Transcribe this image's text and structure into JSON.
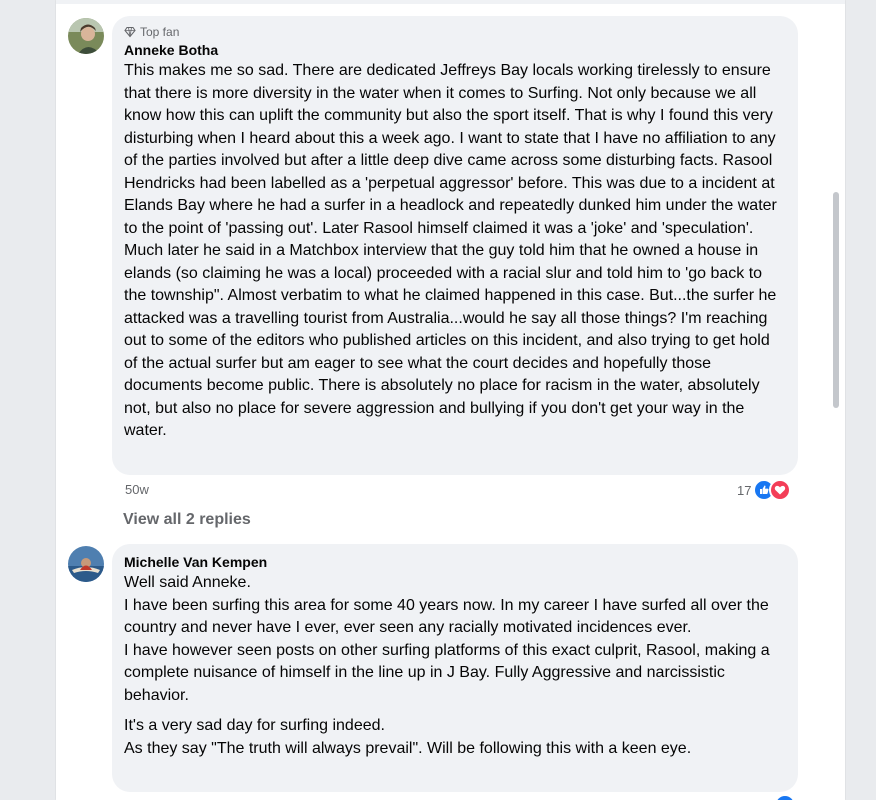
{
  "comments": [
    {
      "badge": "Top fan",
      "author": "Anneke Botha",
      "text": "This makes me so sad. There are dedicated Jeffreys Bay locals working tirelessly to ensure that there is more diversity in the water when it comes to Surfing. Not only because we all know how this can uplift the community but also the sport itself. That is why I found this very disturbing when I heard about this a week ago. I want to state that I have no affiliation to any of the parties involved but after a little deep dive came across some disturbing facts. Rasool Hendricks had been labelled as a 'perpetual aggressor' before. This was due to a incident at Elands Bay where he had a surfer in a headlock and repeatedly dunked him under the water to the point of 'passing out'. Later Rasool himself claimed it was a 'joke' and 'speculation'. Much later he said in a Matchbox interview that the guy told him that he owned a house in elands (so claiming he was a local) proceeded with a racial slur and told him to 'go back to the township\". Almost verbatim to what he claimed happened in this case. But...the surfer he attacked was a travelling tourist from Australia...would he say all those things? I'm reaching out to some of the editors who published articles on this incident, and also trying to get hold of the actual surfer but am eager to see what the court decides and hopefully those documents become public. There is absolutely no place for racism in the water, absolutely not, but also no place for severe aggression and bullying if you don't get your way in the water.",
      "time": "50w",
      "reaction_count": "17",
      "replies_label": "View all 2 replies"
    },
    {
      "author": "Michelle Van Kempen",
      "text_p1": "Well said Anneke.\nI have been surfing this area for some 40 years now. In my career I have surfed all over the country and never have I ever, ever seen any racially motivated incidences ever.\nI have however seen posts on other surfing platforms of this exact culprit, Rasool, making a complete nuisance of himself in the line up in J Bay. Fully Aggressive and narcissistic behavior.",
      "text_p2": "It's a very sad day for surfing indeed.\nAs they say \"The truth will always prevail\". Will be following this with a keen eye."
    }
  ],
  "icons": {
    "badge": "diamond-icon",
    "like": "like-icon",
    "love": "love-icon"
  },
  "colors": {
    "bubble": "#f0f2f5",
    "like": "#1877f2",
    "love": "#f33e58",
    "meta": "#65676b"
  }
}
